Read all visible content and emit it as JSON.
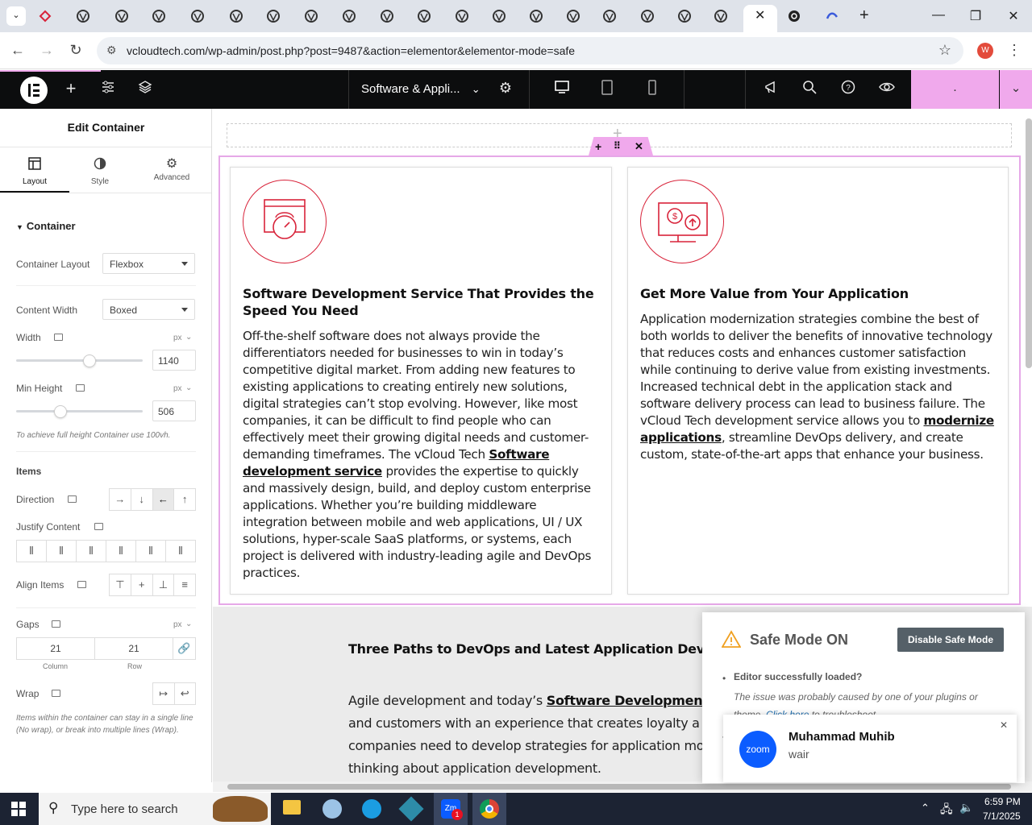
{
  "browser": {
    "url": "vcloudtech.com/wp-admin/post.php?post=9487&action=elementor&elementor-mode=safe",
    "profile_initial": "W",
    "tab_count": 19
  },
  "elementor": {
    "page_title": "Software & Appli...",
    "publish_label": "."
  },
  "sidebar": {
    "title": "Edit Container",
    "tabs": [
      "Layout",
      "Style",
      "Advanced"
    ],
    "section": "Container",
    "container_layout_label": "Container Layout",
    "container_layout_value": "Flexbox",
    "content_width_label": "Content Width",
    "content_width_value": "Boxed",
    "width_label": "Width",
    "width_unit": "px",
    "width_value": "1140",
    "min_height_label": "Min Height",
    "min_height_unit": "px",
    "min_height_value": "506",
    "min_height_note": "To achieve full height Container use 100vh.",
    "items_heading": "Items",
    "direction_label": "Direction",
    "justify_label": "Justify Content",
    "align_label": "Align Items",
    "gaps_label": "Gaps",
    "gaps_unit": "px",
    "gap_column": "21",
    "gap_row": "21",
    "gap_column_label": "Column",
    "gap_row_label": "Row",
    "wrap_label": "Wrap",
    "wrap_note": "Items within the container can stay in a single line (No wrap), or break into multiple lines (Wrap)."
  },
  "cards": [
    {
      "title": "Software Development Service That Provides the Speed You Need",
      "body_before": "Off-the-shelf software does not always provide the differentiators needed for businesses to win in today’s competitive digital market. From adding new features to existing applications to creating entirely new solutions, digital strategies can’t stop evolving. However, like most companies, it can be difficult to find people who can effectively meet their growing digital needs and customer-demanding timeframes. The vCloud Tech",
      "link": "Software development service",
      "body_after": "provides the expertise to quickly and massively design, build, and deploy custom enterprise applications. Whether you’re building middleware integration between mobile and web applications, UI / UX solutions, hyper-scale SaaS platforms, or systems, each project is delivered with industry-leading agile and DevOps practices."
    },
    {
      "title": "Get More Value from Your Application",
      "body_before": "Application modernization strategies combine the best of both worlds to deliver the benefits of innovative technology that reduces costs and enhances customer satisfaction while continuing to derive value from existing investments. Increased technical debt in the application stack and software delivery process can lead to business failure. The vCloud Tech development service allows you to",
      "link": "modernize applications",
      "body_after": ", streamline DevOps delivery, and create custom, state-of-the-art apps that enhance your business."
    }
  ],
  "section2": {
    "heading": "Three Paths to DevOps and Latest Application Developme",
    "line1_before": "Agile development and today’s ",
    "line1_link": "Software Development To",
    "line2": "and customers with an experience that creates loyalty a",
    "line3": "companies need to develop strategies for application mo",
    "line4": "thinking about application development."
  },
  "safe_mode": {
    "title": "Safe Mode ON",
    "button": "Disable Safe Mode",
    "bullet1": "Editor successfully loaded?",
    "note_before": "The issue was probably caused by one of your plugins or theme. ",
    "note_link": "Click here",
    "note_after": " to troubleshoot"
  },
  "zoom_notification": {
    "app": "zoom",
    "sender": "Muhammad Muhib",
    "message": "wair"
  },
  "taskbar": {
    "search_placeholder": "Type here to search",
    "time": "6:59 PM",
    "date": "7/1/2025",
    "badge": "1"
  },
  "colors": {
    "accent_red": "#d8233a",
    "elementor_pink": "#f0a9ec",
    "selection_pink": "#e6a8e8",
    "dark_bar": "#0c0d0e"
  }
}
